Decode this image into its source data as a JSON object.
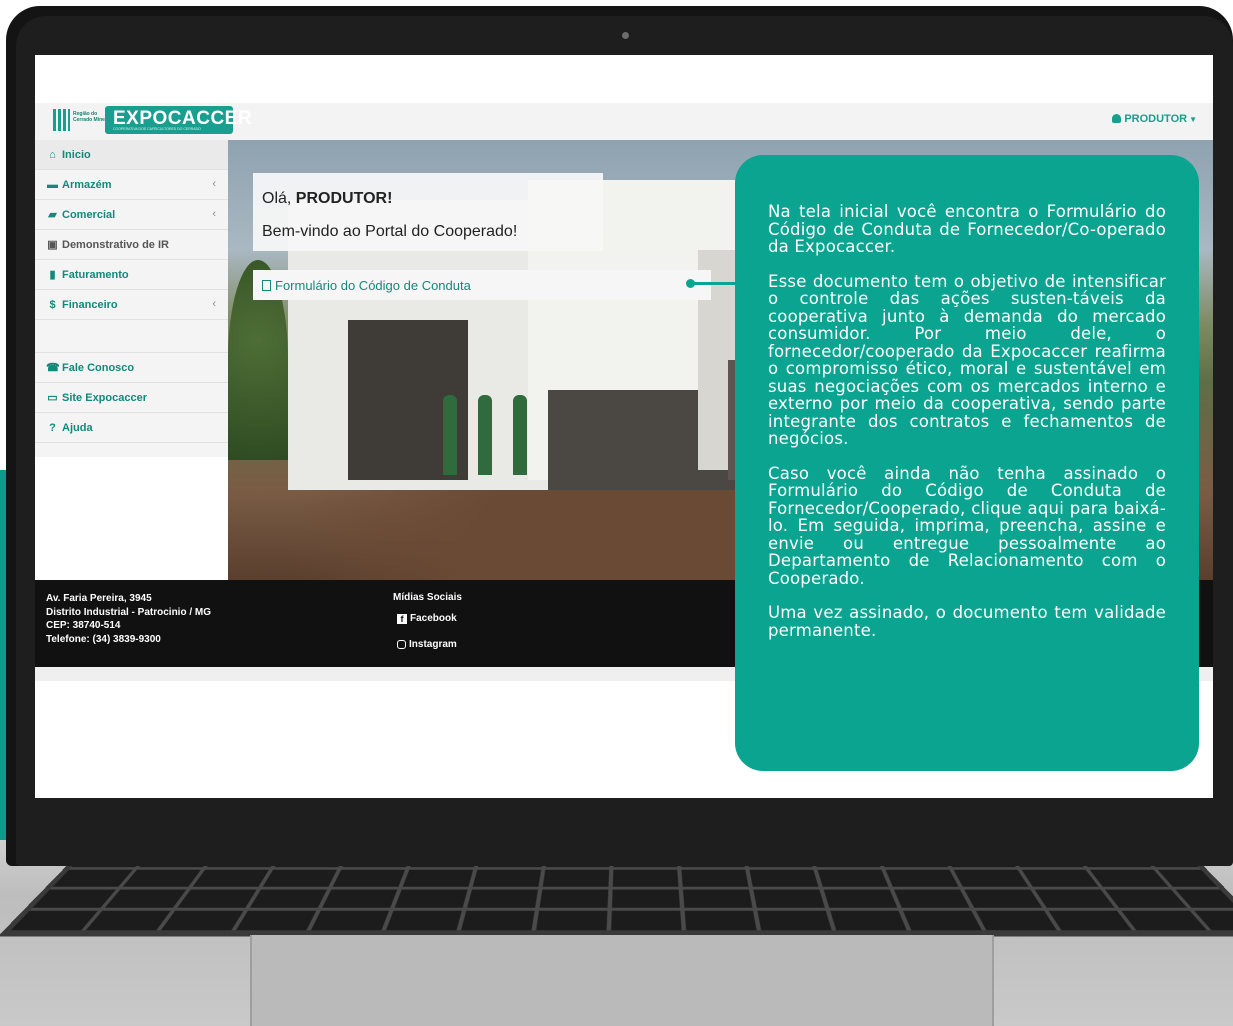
{
  "app": {
    "brand": "EXPOCACCER",
    "brand_sub": "COOPERATIVA DOS CAFEICULTORES DO CERRADO",
    "region_label": "Região do Cerrado Mineiro"
  },
  "header": {
    "user_label": "PRODUTOR"
  },
  "sidebar": {
    "items": [
      {
        "label": "Inicio",
        "icon": "home-icon",
        "expandable": false
      },
      {
        "label": "Armazém",
        "icon": "warehouse-icon",
        "expandable": true
      },
      {
        "label": "Comercial",
        "icon": "briefcase-icon",
        "expandable": true
      },
      {
        "label": "Demonstrativo de IR",
        "icon": "money-icon",
        "expandable": false
      },
      {
        "label": "Faturamento",
        "icon": "file-icon",
        "expandable": false
      },
      {
        "label": "Financeiro",
        "icon": "dollar-icon",
        "expandable": true
      },
      {
        "label": "Fale Conosco",
        "icon": "phone-icon",
        "expandable": false
      },
      {
        "label": "Site Expocaccer",
        "icon": "monitor-icon",
        "expandable": false
      },
      {
        "label": "Ajuda",
        "icon": "help-icon",
        "expandable": false
      }
    ]
  },
  "main": {
    "greeting_prefix": "Olá, ",
    "greeting_name": "PRODUTOR!",
    "subtitle": "Bem-vindo ao Portal do Cooperado!",
    "form_link": "Formulário do Código de Conduta"
  },
  "footer": {
    "address_lines": [
      "Av. Faria Pereira, 3945",
      "Distrito Industrial - Patrocinio / MG",
      "CEP: 38740-514",
      "Telefone: (34) 3839-9300"
    ],
    "social_title": "Mídias Sociais",
    "facebook": "Facebook",
    "instagram": "Instagram"
  },
  "callout": {
    "paragraphs": [
      "Na tela inicial você encontra o Formulário do Código de Conduta de Fornecedor/Co-operado da Expocaccer.",
      "Esse documento tem o objetivo de intensificar o controle das ações susten-táveis da cooperativa junto à demanda do mercado consumidor. Por meio dele, o fornecedor/cooperado da Expocaccer reafirma o compromisso ético, moral e sustentável em suas negociações com os mercados interno e externo por meio da cooperativa, sendo parte integrante dos contratos e fechamentos de negócios.",
      "Caso você ainda não tenha assinado o Formulário do Código de Conduta de Fornecedor/Cooperado, clique aqui para baixá-lo. Em seguida, imprima, preencha, assine e envie ou entregue pessoalmente ao Departamento de Relacionamento com o Cooperado.",
      "Uma vez assinado, o documento tem validade permanente."
    ]
  },
  "colors": {
    "accent": "#1a9e8f",
    "callout_bg": "#0aa491",
    "footer_bg": "#111111"
  }
}
